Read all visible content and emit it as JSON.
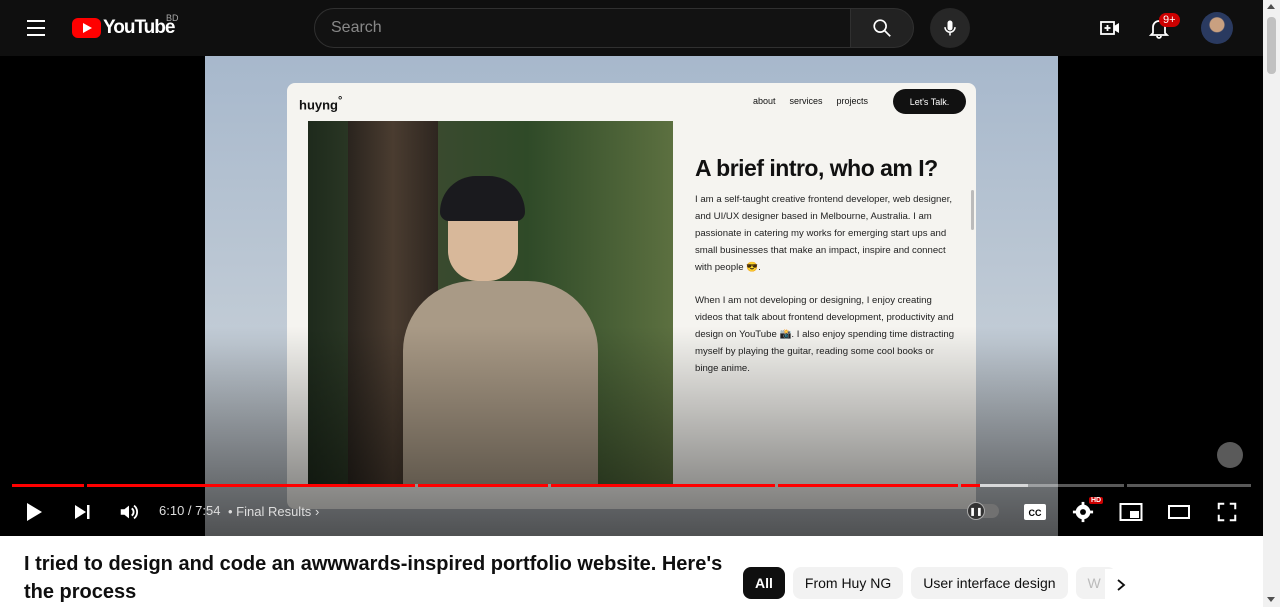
{
  "header": {
    "logo_text": "YouTube",
    "country_code": "BD",
    "search_placeholder": "Search",
    "notification_count": "9+"
  },
  "video_frame": {
    "site_logo": "huyng",
    "site_logo_mark": "°",
    "nav": [
      "about",
      "services",
      "projects"
    ],
    "cta": "Let's Talk.",
    "intro_title": "A brief intro, who am I?",
    "para1": "I am a self-taught creative frontend developer, web designer, and UI/UX designer based in Melbourne, Australia. I am passionate in catering my works for emerging start ups and small businesses that make an impact, inspire and connect with people 😎.",
    "para2": "When I am not developing or designing, I enjoy creating videos that talk about frontend development, productivity and design on YouTube 📸. I also enjoy spending time distracting myself by playing the guitar, reading some cool books or binge anime."
  },
  "controls": {
    "current_time": "6:10",
    "duration": "7:54",
    "time_separator": " / ",
    "chapter": "Final Results",
    "hd_label": "HD",
    "progress_fraction": 0.781
  },
  "below_video": {
    "title": "I tried to design and code an awwwards-inspired portfolio website. Here's the process",
    "chips": [
      "All",
      "From Huy NG",
      "User interface design",
      "W"
    ]
  },
  "colors": {
    "accent_red": "#ff0000",
    "background_dark": "#0f0f0f"
  }
}
